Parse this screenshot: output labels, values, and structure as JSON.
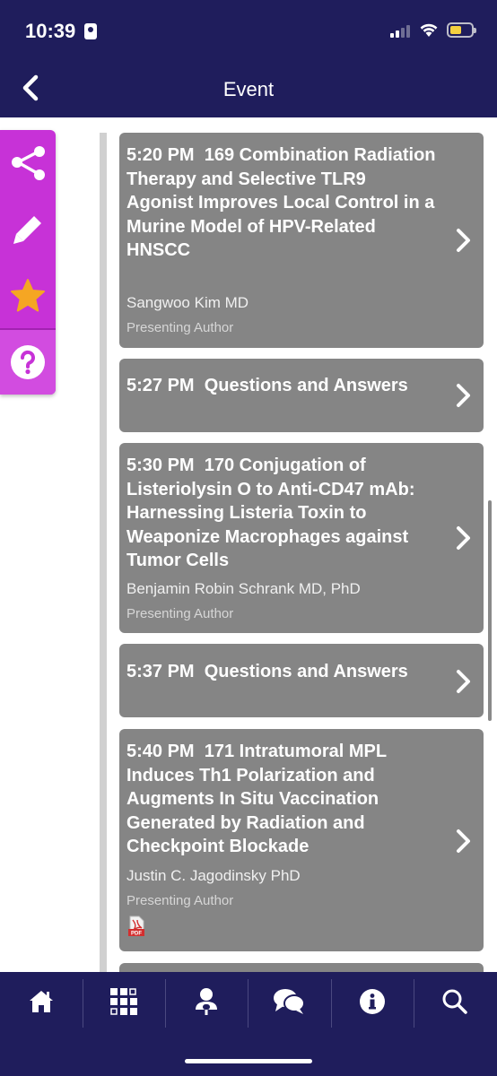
{
  "status_bar": {
    "time": "10:39"
  },
  "header": {
    "title": "Event"
  },
  "side_tools": [
    "share-icon",
    "pencil-icon",
    "star-icon",
    "help-icon"
  ],
  "sessions": [
    {
      "time": "5:20 PM",
      "title": "169 Combination Radiation Therapy and Selective TLR9 Agonist Improves Local Control in a Murine Model of HPV-Related HNSCC",
      "author": "Sangwoo Kim MD",
      "role": "Presenting Author"
    },
    {
      "time": "5:27 PM",
      "title": "Questions and Answers"
    },
    {
      "time": "5:30 PM",
      "title": "170 Conjugation of Listeriolysin O to Anti-CD47 mAb: Harnessing Listeria Toxin to Weaponize Macrophages against Tumor Cells",
      "author": "Benjamin Robin Schrank MD, PhD",
      "role": "Presenting Author"
    },
    {
      "time": "5:37 PM",
      "title": "Questions and Answers"
    },
    {
      "time": "5:40 PM",
      "title": "171 Intratumoral MPL Induces Th1 Polarization and Augments In Situ Vaccination Generated by Radiation and Checkpoint Blockade",
      "author": "Justin C. Jagodinsky PhD",
      "role": "Presenting Author",
      "attachment": "PDF"
    }
  ],
  "bottom_nav": [
    "home-icon",
    "grid-icon",
    "speaker-icon",
    "chat-icon",
    "info-icon",
    "search-icon"
  ],
  "colors": {
    "header_bg": "#1f1d5c",
    "side_panel": "#c732d7",
    "card_bg": "#858585",
    "star": "#f5a623"
  }
}
